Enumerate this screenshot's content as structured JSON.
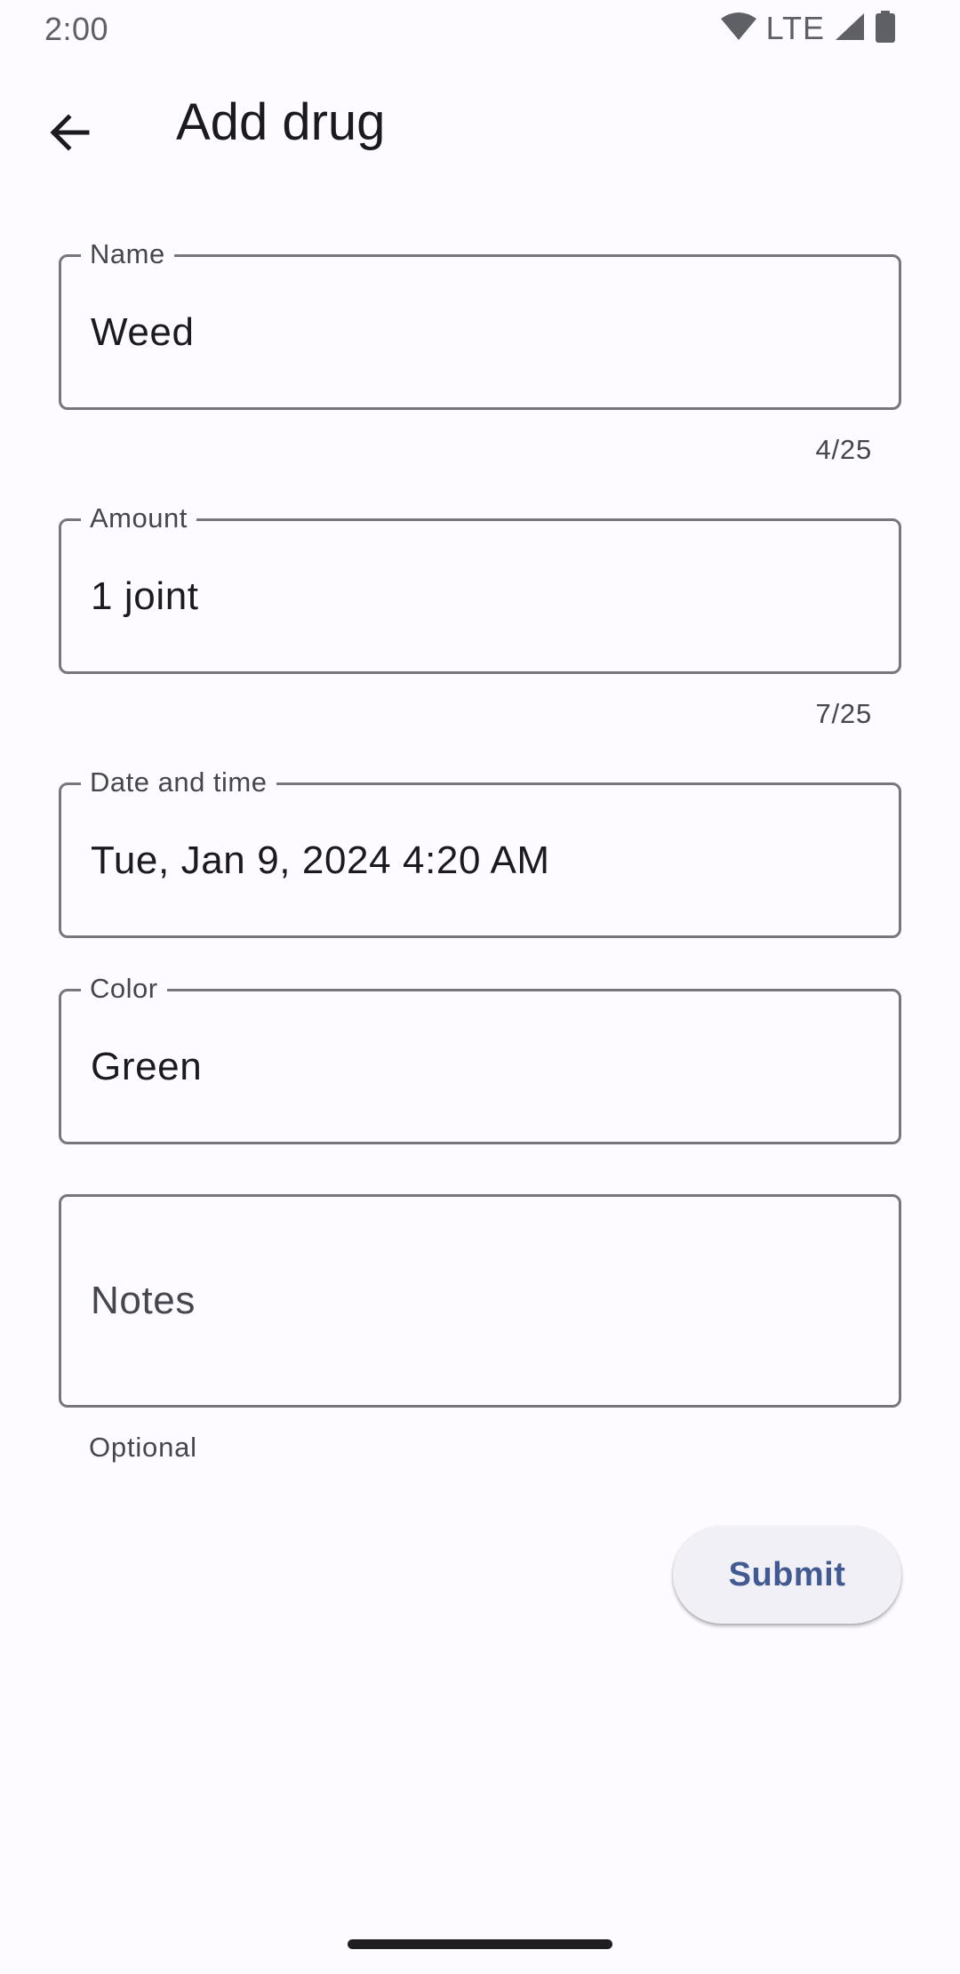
{
  "status_bar": {
    "time": "2:00",
    "network": "LTE",
    "icons": [
      "wifi-icon",
      "cell-signal-icon",
      "battery-icon"
    ]
  },
  "app_bar": {
    "title": "Add drug",
    "back_icon": "arrow-back-icon"
  },
  "form": {
    "name": {
      "label": "Name",
      "value": "Weed",
      "counter": "4/25"
    },
    "amount": {
      "label": "Amount",
      "value": "1 joint",
      "counter": "7/25"
    },
    "datetime": {
      "label": "Date and time",
      "value": "Tue, Jan 9, 2024 4:20 AM"
    },
    "color": {
      "label": "Color",
      "value": "Green"
    },
    "notes": {
      "placeholder": "Notes",
      "helper": "Optional"
    }
  },
  "actions": {
    "submit_label": "Submit"
  },
  "colors": {
    "background": "#fdfbff",
    "outline": "#77767c",
    "primary": "#415a91",
    "button_surface": "#f1f0f7"
  }
}
